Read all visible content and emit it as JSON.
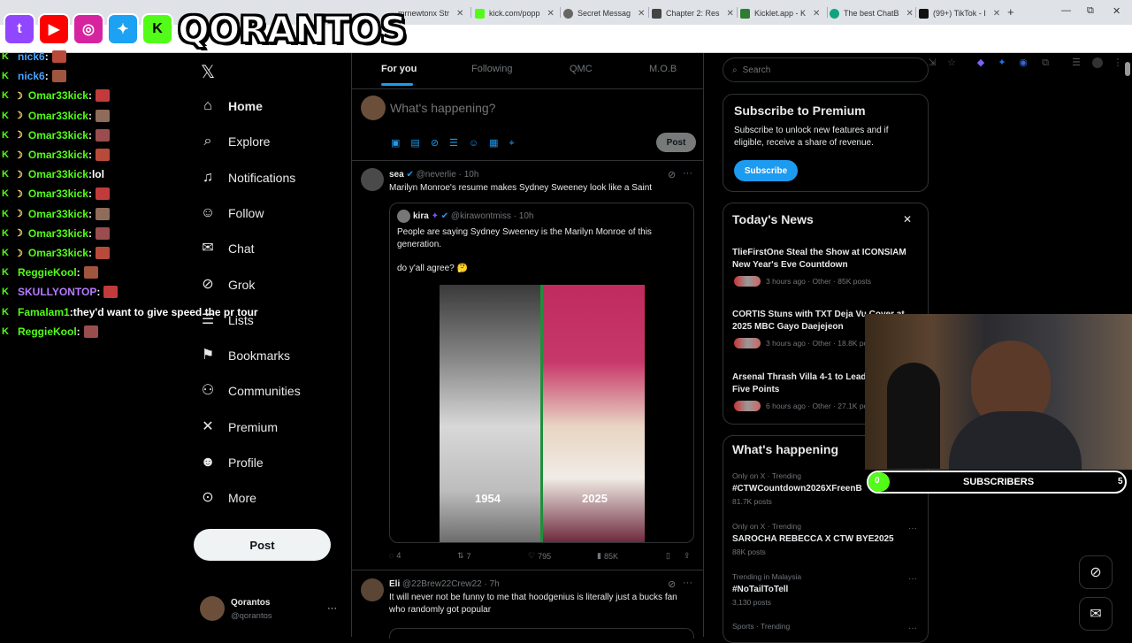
{
  "browser": {
    "tabs": [
      {
        "label": "mrnewtonx Str"
      },
      {
        "label": "kick.com/popp"
      },
      {
        "label": "Secret Messag"
      },
      {
        "label": "Chapter 2: Res"
      },
      {
        "label": "Kicklet.app - K"
      },
      {
        "label": "The best ChatB"
      },
      {
        "label": "(99+) TikTok - I"
      }
    ],
    "new_tab": "+",
    "window_controls": {
      "minimize": "—",
      "restore": "⧉",
      "close": "✕"
    }
  },
  "overlay": {
    "brand": "QORANTOS",
    "social_icons": [
      "twitch-icon",
      "youtube-icon",
      "instagram-icon",
      "twitter-icon",
      "kick-icon"
    ],
    "chat": [
      {
        "user": "nick6",
        "msg": ""
      },
      {
        "user": "nick6",
        "msg": ""
      },
      {
        "user": "Omar33kick",
        "msg": ""
      },
      {
        "user": "Omar33kick",
        "msg": ""
      },
      {
        "user": "Omar33kick",
        "msg": ""
      },
      {
        "user": "Omar33kick",
        "msg": ""
      },
      {
        "user": "Omar33kick",
        "msg": "lol"
      },
      {
        "user": "Omar33kick",
        "msg": ""
      },
      {
        "user": "Omar33kick",
        "msg": ""
      },
      {
        "user": "Omar33kick",
        "msg": ""
      },
      {
        "user": "Omar33kick",
        "msg": ""
      },
      {
        "user": "ReggieKool",
        "msg": ""
      },
      {
        "user": "SKULLYONTOP",
        "msg": ""
      },
      {
        "user": "Famalam1",
        "msg": "they'd want to give speed the pr tour"
      },
      {
        "user": "ReggieKool",
        "msg": ""
      }
    ],
    "subscribers": {
      "current": "0",
      "label": "SUBSCRIBERS",
      "goal": "5"
    }
  },
  "nav": {
    "items": [
      {
        "label": "Home",
        "icon": "home-icon"
      },
      {
        "label": "Explore",
        "icon": "search-icon"
      },
      {
        "label": "Notifications",
        "icon": "bell-icon"
      },
      {
        "label": "Follow",
        "icon": "follow-icon"
      },
      {
        "label": "Chat",
        "icon": "mail-icon"
      },
      {
        "label": "Grok",
        "icon": "grok-icon"
      },
      {
        "label": "Lists",
        "icon": "list-icon"
      },
      {
        "label": "Bookmarks",
        "icon": "bookmark-icon"
      },
      {
        "label": "Communities",
        "icon": "communities-icon"
      },
      {
        "label": "Premium",
        "icon": "x-icon"
      },
      {
        "label": "Profile",
        "icon": "person-icon"
      },
      {
        "label": "More",
        "icon": "more-icon"
      }
    ],
    "post_button": "Post",
    "account": {
      "name": "Qorantos",
      "handle": "@qorantos"
    }
  },
  "feed": {
    "tabs": [
      "For you",
      "Following",
      "QMC",
      "M.O.B"
    ],
    "composer": {
      "placeholder": "What's happening?",
      "post_button": "Post"
    },
    "tweet1": {
      "name": "sea",
      "handle": "@neverlie",
      "time": "· 10h",
      "text": "Marilyn Monroe's resume makes Sydney Sweeney look like a Saint",
      "quote": {
        "name": "kira",
        "handle": "@kirawontmiss",
        "time": "· 10h",
        "text": "People are saying Sydney Sweeney is the Marilyn Monroe of this generation.",
        "text2": "do y'all agree? 🤔",
        "image_left_caption": "1954",
        "image_right_caption": "2025"
      },
      "stats": {
        "replies": "4",
        "reposts": "7",
        "likes": "795",
        "views": "85K"
      }
    },
    "tweet2": {
      "name": "Eli",
      "handle": "@22Brew22Crew22",
      "time": "· 7h",
      "text": "It will never not be funny to me that hoodgenius is literally just a bucks fan who randomly got popular"
    }
  },
  "right": {
    "search_placeholder": "Search",
    "premium": {
      "title": "Subscribe to Premium",
      "desc": "Subscribe to unlock new features and if eligible, receive a share of revenue.",
      "button": "Subscribe"
    },
    "news": {
      "title": "Today's News",
      "items": [
        {
          "title": "TlieFirstOne Steal the Show at ICONSIAM New Year's Eve Countdown",
          "meta": "3 hours ago · Other · 85K posts"
        },
        {
          "title": "CORTIS Stuns with TXT Deja Vu Cover at 2025 MBC Gayo Daejejeon",
          "meta": "3 hours ago · Other · 18.8K po"
        },
        {
          "title": "Arsenal Thrash Villa 4-1 to Lead League by Five Points",
          "meta": "6 hours ago · Other · 27.1K po"
        }
      ]
    },
    "happening": {
      "title": "What's happening",
      "items": [
        {
          "category": "Only on X · Trending",
          "title": "#CTWCountdown2026XFreenB",
          "count": "81.7K posts"
        },
        {
          "category": "Only on X · Trending",
          "title": "SAROCHA REBECCA X CTW BYE2025",
          "count": "88K posts"
        },
        {
          "category": "Trending in Malaysia",
          "title": "#NoTailToTell",
          "count": "3,130 posts"
        },
        {
          "category": "Sports · Trending",
          "title": "",
          "count": ""
        }
      ]
    }
  },
  "colors": {
    "accent": "#1d9bf0",
    "kick_green": "#53fc18",
    "background": "#000000"
  }
}
